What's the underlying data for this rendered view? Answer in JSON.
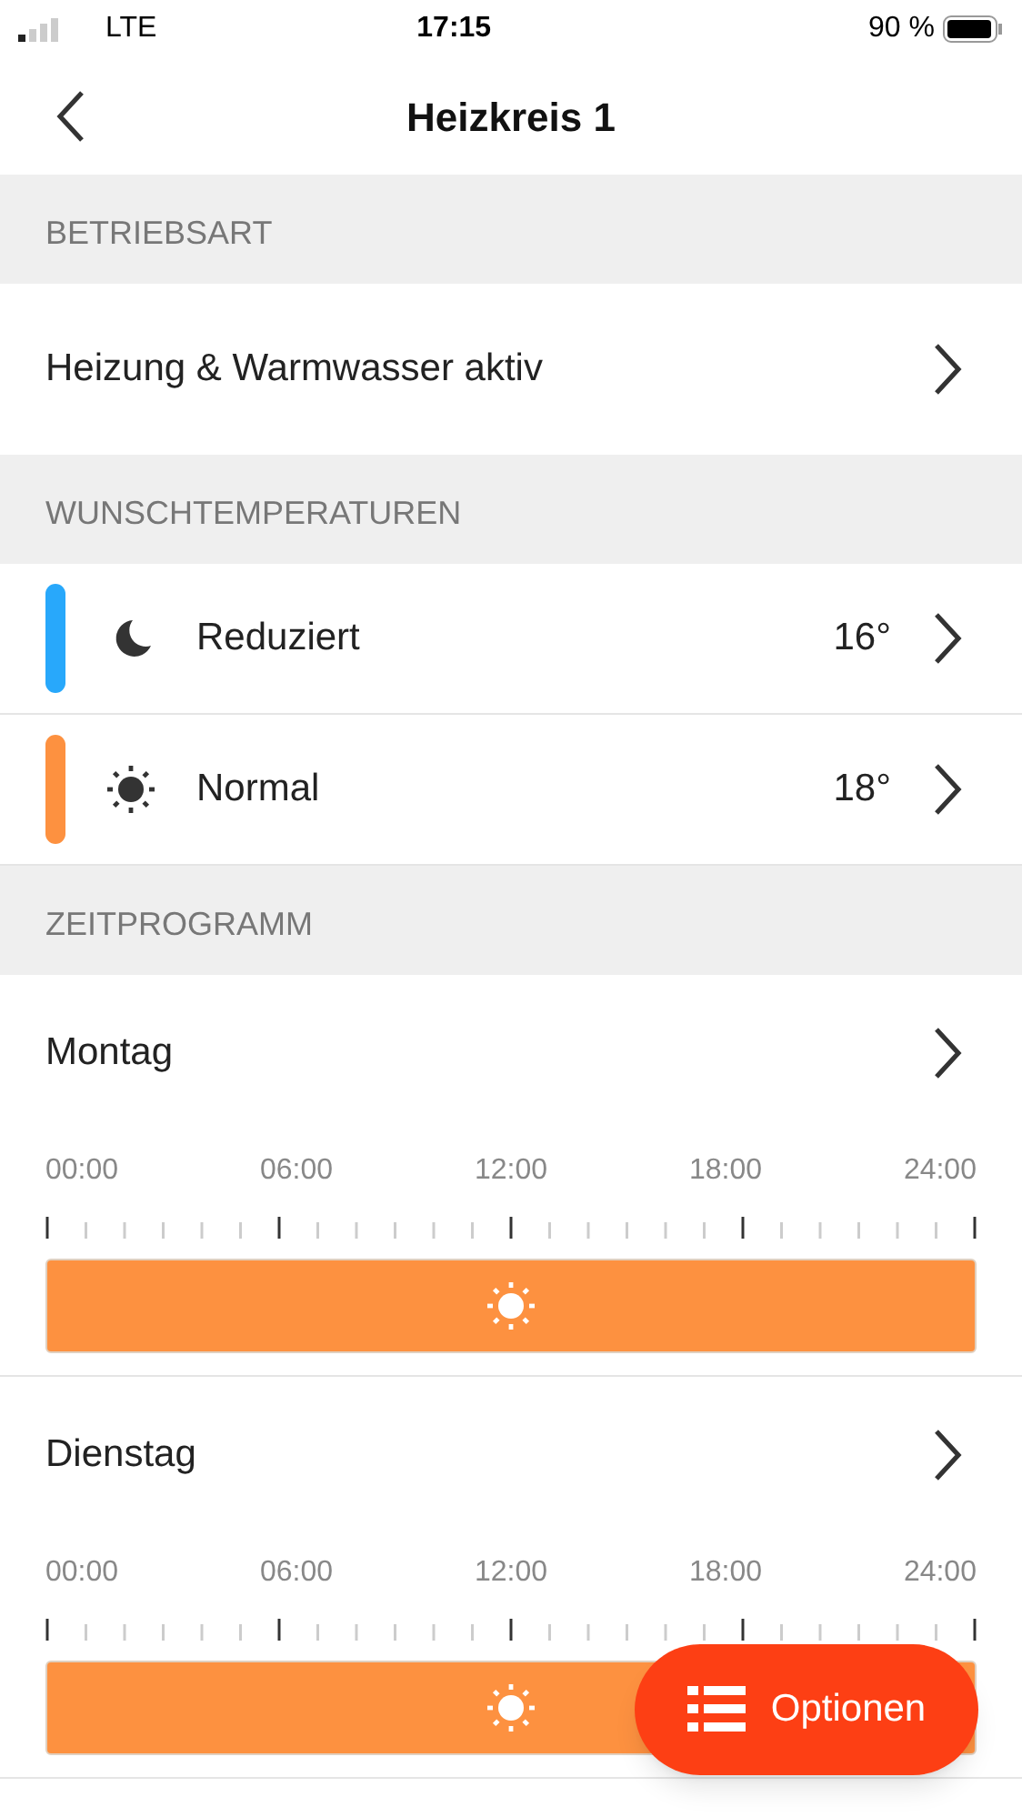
{
  "status_bar": {
    "network": "LTE",
    "time": "17:15",
    "battery": "90 %"
  },
  "nav": {
    "title": "Heizkreis 1"
  },
  "sections": [
    {
      "header": "BETRIEBSART",
      "kind": "mode",
      "rows": [
        {
          "label": "Heizung & Warmwasser aktiv"
        }
      ]
    },
    {
      "header": "WUNSCHTEMPERATUREN",
      "kind": "temps",
      "rows": [
        {
          "label": "Reduziert",
          "value": "16°",
          "color": "#28a8fb",
          "kind": "moon"
        },
        {
          "label": "Normal",
          "value": "18°",
          "color": "#fd9140",
          "kind": "sun"
        }
      ]
    },
    {
      "header": "ZEITPROGRAMM",
      "kind": "schedule",
      "rows": [
        {
          "label": "Montag",
          "ticks": [
            "00:00",
            "06:00",
            "12:00",
            "18:00",
            "24:00"
          ],
          "segments": [
            {
              "kind": "sun",
              "color": "#fd9140"
            }
          ]
        },
        {
          "label": "Dienstag",
          "ticks": [
            "00:00",
            "06:00",
            "12:00",
            "18:00",
            "24:00"
          ],
          "segments": [
            {
              "kind": "sun",
              "color": "#fd9140"
            }
          ]
        }
      ]
    }
  ],
  "fab": {
    "label": "Optionen"
  }
}
